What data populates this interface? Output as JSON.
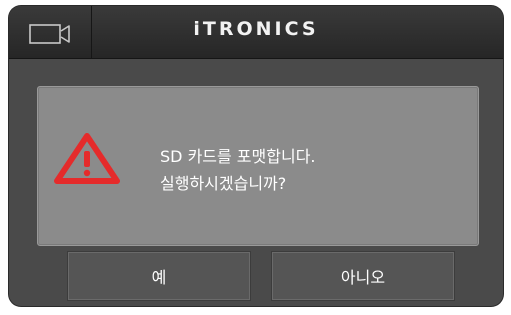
{
  "header": {
    "brand": "iTRONICS",
    "camera_icon": "video-camera-icon"
  },
  "dialog": {
    "warning_icon": "warning-triangle-icon",
    "message_line1": "SD 카드를 포맷합니다.",
    "message_line2": "실행하시겠습니까?"
  },
  "buttons": {
    "yes_label": "예",
    "no_label": "아니오"
  },
  "colors": {
    "warning": "#e52b2b",
    "panel": "#8b8b8b",
    "button": "#555555"
  }
}
